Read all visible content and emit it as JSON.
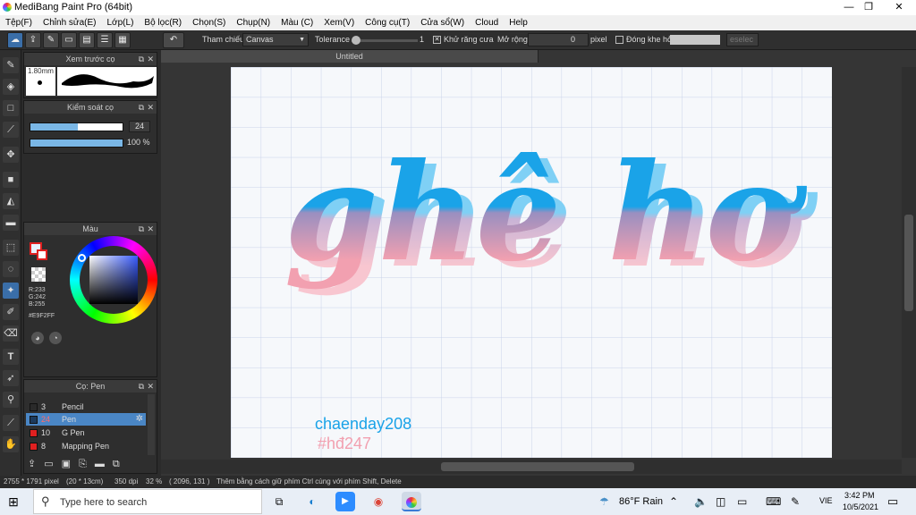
{
  "window": {
    "title": "MediBang Paint Pro (64bit)",
    "min": "—",
    "max": "❐",
    "close": "✕"
  },
  "menu": [
    "Tệp(F)",
    "Chỉnh sửa(E)",
    "Lớp(L)",
    "Bộ lọc(R)",
    "Chọn(S)",
    "Chụp(N)",
    "Màu (C)",
    "Xem(V)",
    "Công cụ(T)",
    "Cửa sổ(W)",
    "Cloud",
    "Help"
  ],
  "toolbar": {
    "ref_label": "Tham chiếu",
    "ref_value": "Canvas",
    "tolerance_label": "Tolerance",
    "tolerance_value": "1",
    "antialias_label": "Khử răng cưa",
    "expand_label": "Mở rộng",
    "expand_value": "0",
    "pixel_label": "pixel",
    "close_gap_label": "Đóng khe hở",
    "deselect_label": "eselec"
  },
  "preview_panel": {
    "title": "Xem trước cọ",
    "size": "1.80mm"
  },
  "brush_control": {
    "title": "Kiểm soát cọ",
    "size_value": "24",
    "opacity_value": "100 %",
    "size_fraction": 0.51,
    "opacity_fraction": 1.0
  },
  "color_panel": {
    "title": "Màu",
    "r": "R:233",
    "g": "G:242",
    "b": "B:255",
    "hex": "#E9F2FF",
    "fg_color": "#e9f2ff"
  },
  "brush_panel": {
    "title": "Cọ: Pen",
    "items": [
      {
        "num": "3",
        "name": "Pencil",
        "color": "#2a2a2a"
      },
      {
        "num": "24",
        "name": "Pen",
        "color": "#1c3a5c",
        "selected": true
      },
      {
        "num": "10",
        "name": "G Pen",
        "color": "#e02020"
      },
      {
        "num": "8",
        "name": "Mapping Pen",
        "color": "#e02020"
      }
    ]
  },
  "document": {
    "tab": "Untitled",
    "artwork_text": "ghê hơ",
    "credit1": "chaenday208",
    "credit2": "#hđ247"
  },
  "status": {
    "size": "2755 * 1791 pixel",
    "cm": "(20 * 13cm)",
    "dpi": "350 dpi",
    "zoom": "32 %",
    "coords": "( 2096, 131 )",
    "hint": "Thêm bằng cách giữ phím Ctrl cùng với phím Shift, Delete"
  },
  "taskbar": {
    "search_placeholder": "Type here to search",
    "weather": "86°F  Rain",
    "lang": "VIE",
    "time": "3:42 PM",
    "date": "10/5/2021"
  },
  "colors": {
    "accent": "#3a6ea8",
    "text_blue": "#1aa3e8",
    "text_pink": "#f2a0b0"
  }
}
